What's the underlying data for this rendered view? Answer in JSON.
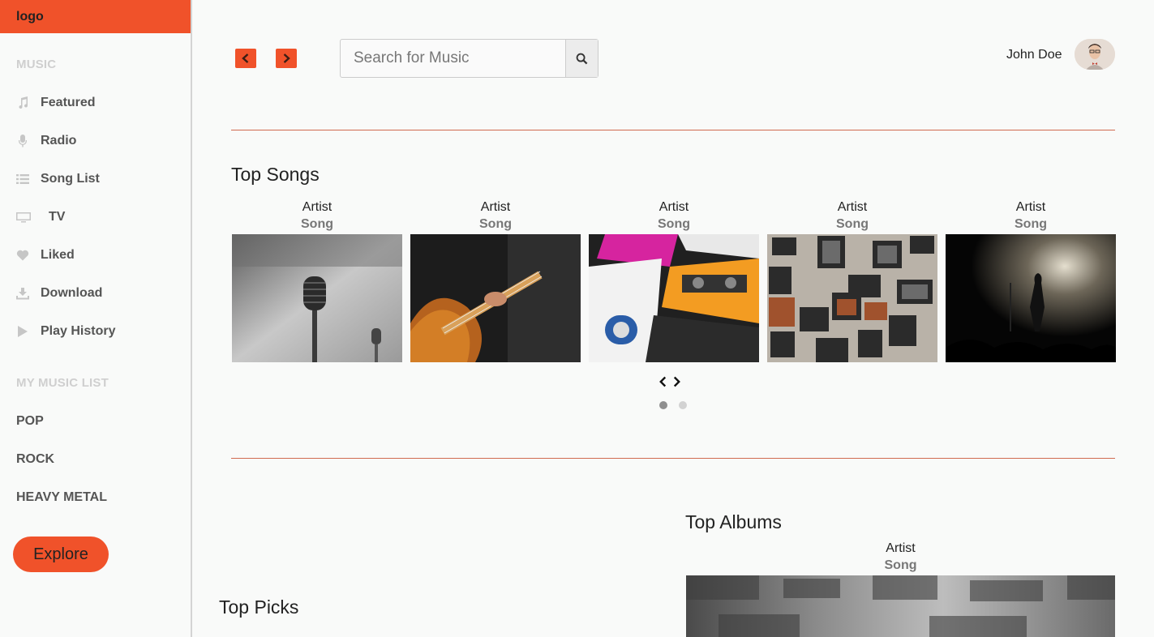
{
  "logo": "logo",
  "sidebar": {
    "music_title": "MUSIC",
    "items": [
      {
        "label": "Featured",
        "icon": "music-note-icon"
      },
      {
        "label": "Radio",
        "icon": "microphone-icon"
      },
      {
        "label": "Song List",
        "icon": "list-icon"
      },
      {
        "label": "TV",
        "icon": "tv-icon"
      },
      {
        "label": "Liked",
        "icon": "heart-icon"
      },
      {
        "label": "Download",
        "icon": "download-icon"
      },
      {
        "label": "Play History",
        "icon": "play-icon"
      }
    ],
    "list_title": "MY MUSIC LIST",
    "lists": [
      "POP",
      "ROCK",
      "HEAVY METAL"
    ],
    "explore_label": "Explore"
  },
  "header": {
    "search_placeholder": "Search for Music",
    "user_name": "John Doe"
  },
  "top_songs": {
    "title": "Top Songs",
    "cards": [
      {
        "artist": "Artist",
        "song": "Song",
        "image": "microphone-photo"
      },
      {
        "artist": "Artist",
        "song": "Song",
        "image": "guitar-photo"
      },
      {
        "artist": "Artist",
        "song": "Song",
        "image": "cassette-tapes-photo"
      },
      {
        "artist": "Artist",
        "song": "Song",
        "image": "amplifiers-wall-photo"
      },
      {
        "artist": "Artist",
        "song": "Song",
        "image": "concert-stage-photo"
      }
    ]
  },
  "top_albums": {
    "title": "Top Albums",
    "card": {
      "artist": "Artist",
      "song": "Song"
    }
  },
  "top_picks": {
    "title": "Top Picks"
  },
  "colors": {
    "accent": "#f0522a",
    "divider": "#d06a50"
  }
}
